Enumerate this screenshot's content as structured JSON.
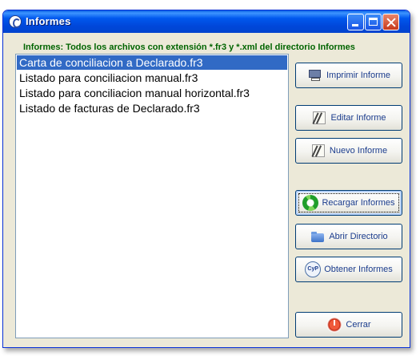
{
  "window": {
    "title": "Informes"
  },
  "header": {
    "label": "Informes: Todos los archivos con extensión *.fr3 y *.xml del directorio Informes"
  },
  "files": {
    "items": [
      {
        "label": "Carta de conciliacion a Declarado.fr3",
        "selected": true
      },
      {
        "label": "Listado para conciliacion manual.fr3",
        "selected": false
      },
      {
        "label": "Listado para conciliacion manual horizontal.fr3",
        "selected": false
      },
      {
        "label": "Listado de facturas de Declarado.fr3",
        "selected": false
      }
    ]
  },
  "buttons": {
    "imprimir": {
      "label": "Imprimir Informe",
      "icon": "printer-icon"
    },
    "editar": {
      "label": "Editar Informe",
      "icon": "drafting-compass-icon"
    },
    "nuevo": {
      "label": "Nuevo Informe",
      "icon": "drafting-compass-icon"
    },
    "recargar": {
      "label": "Recargar Informes",
      "icon": "refresh-icon"
    },
    "abrir": {
      "label": "Abrir Directorio",
      "icon": "folder-icon"
    },
    "obtener": {
      "label": "Obtener Informes",
      "icon": "cyp-logo-icon",
      "icon_text": "CyP"
    },
    "cerrar": {
      "label": "Cerrar",
      "icon": "power-icon"
    }
  },
  "colors": {
    "title_bar": "#0054E3",
    "header_text": "#006400",
    "selection": "#316AC5",
    "window_bg": "#ECE9D8"
  }
}
